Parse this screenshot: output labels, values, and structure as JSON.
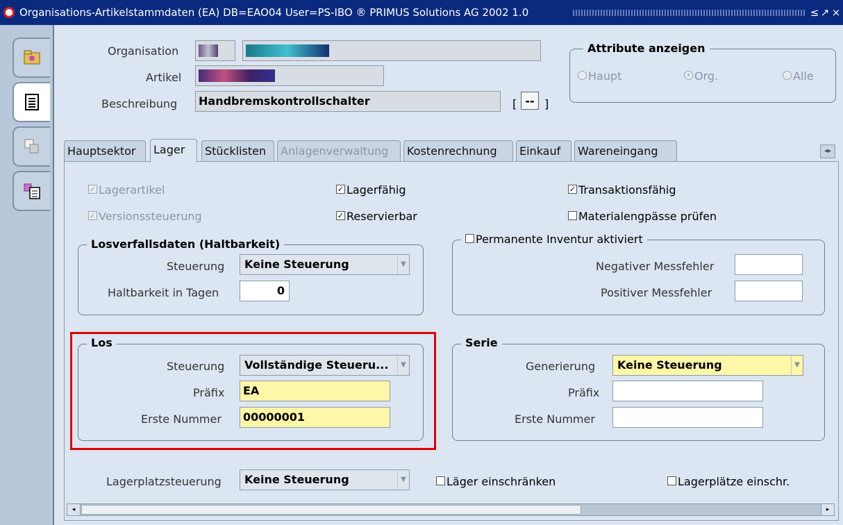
{
  "window": {
    "title": "Organisations-Artikelstammdaten (EA)  DB=EAO04 User=PS-IBO ® PRIMUS Solutions AG 2002 1.0",
    "btn_min": "≤",
    "btn_max": "↗",
    "btn_close": "×"
  },
  "header": {
    "organisation_label": "Organisation",
    "artikel_label": "Artikel",
    "beschreibung_label": "Beschreibung",
    "beschreibung_value": "Handbremskontrollschalter",
    "bracket_left": "[",
    "bracket_mid": "--",
    "bracket_right": "]"
  },
  "attribute": {
    "title": "Attribute anzeigen",
    "options": [
      "Haupt",
      "Org.",
      "Alle"
    ],
    "selected": "Org."
  },
  "tabs": [
    {
      "label": "Hauptsektor",
      "state": "normal"
    },
    {
      "label": "Lager",
      "state": "active"
    },
    {
      "label": "Stücklisten",
      "state": "normal"
    },
    {
      "label": "Anlagenverwaltung",
      "state": "disabled"
    },
    {
      "label": "Kostenrechnung",
      "state": "normal"
    },
    {
      "label": "Einkauf",
      "state": "normal"
    },
    {
      "label": "Wareneingang",
      "state": "normal"
    }
  ],
  "checkboxes": {
    "lagerartikel": {
      "label": "Lagerartikel",
      "checked": true,
      "disabled": true
    },
    "versionssteuerung": {
      "label": "Versionssteuerung",
      "checked": true,
      "disabled": true
    },
    "lagerfaehig": {
      "label": "Lagerfähig",
      "checked": true,
      "disabled": false
    },
    "reservierbar": {
      "label": "Reservierbar",
      "checked": true,
      "disabled": false
    },
    "transaktionsfaehig": {
      "label": "Transaktionsfähig",
      "checked": true,
      "disabled": false
    },
    "materialengpaesse": {
      "label": "Materialengpässe prüfen",
      "checked": false,
      "disabled": false
    }
  },
  "losverfall": {
    "title": "Losverfallsdaten (Haltbarkeit)",
    "steuerung_label": "Steuerung",
    "steuerung_value": "Keine Steuerung",
    "haltbarkeit_label": "Haltbarkeit in Tagen",
    "haltbarkeit_value": "0"
  },
  "inventur": {
    "title": "Permanente Inventur aktiviert",
    "checked": false,
    "neg_label": "Negativer Messfehler",
    "neg_value": "",
    "pos_label": "Positiver Messfehler",
    "pos_value": ""
  },
  "los": {
    "title": "Los",
    "steuerung_label": "Steuerung",
    "steuerung_value": "Vollständige Steueru...",
    "praefix_label": "Präfix",
    "praefix_value": "EA",
    "erste_nummer_label": "Erste Nummer",
    "erste_nummer_value": "00000001"
  },
  "serie": {
    "title": "Serie",
    "generierung_label": "Generierung",
    "generierung_value": "Keine Steuerung",
    "praefix_label": "Präfix",
    "praefix_value": "",
    "erste_nummer_label": "Erste Nummer",
    "erste_nummer_value": ""
  },
  "bottom": {
    "lagerplatz_label": "Lagerplatzsteuerung",
    "lagerplatz_value": "Keine Steuerung",
    "laeger_label": "Läger einschränken",
    "lagerplaetze_label": "Lagerplätze einschr."
  },
  "colors": {
    "titlebar": "#0a2a80",
    "highlight": "#e00000",
    "required_field": "#fff7a8"
  }
}
